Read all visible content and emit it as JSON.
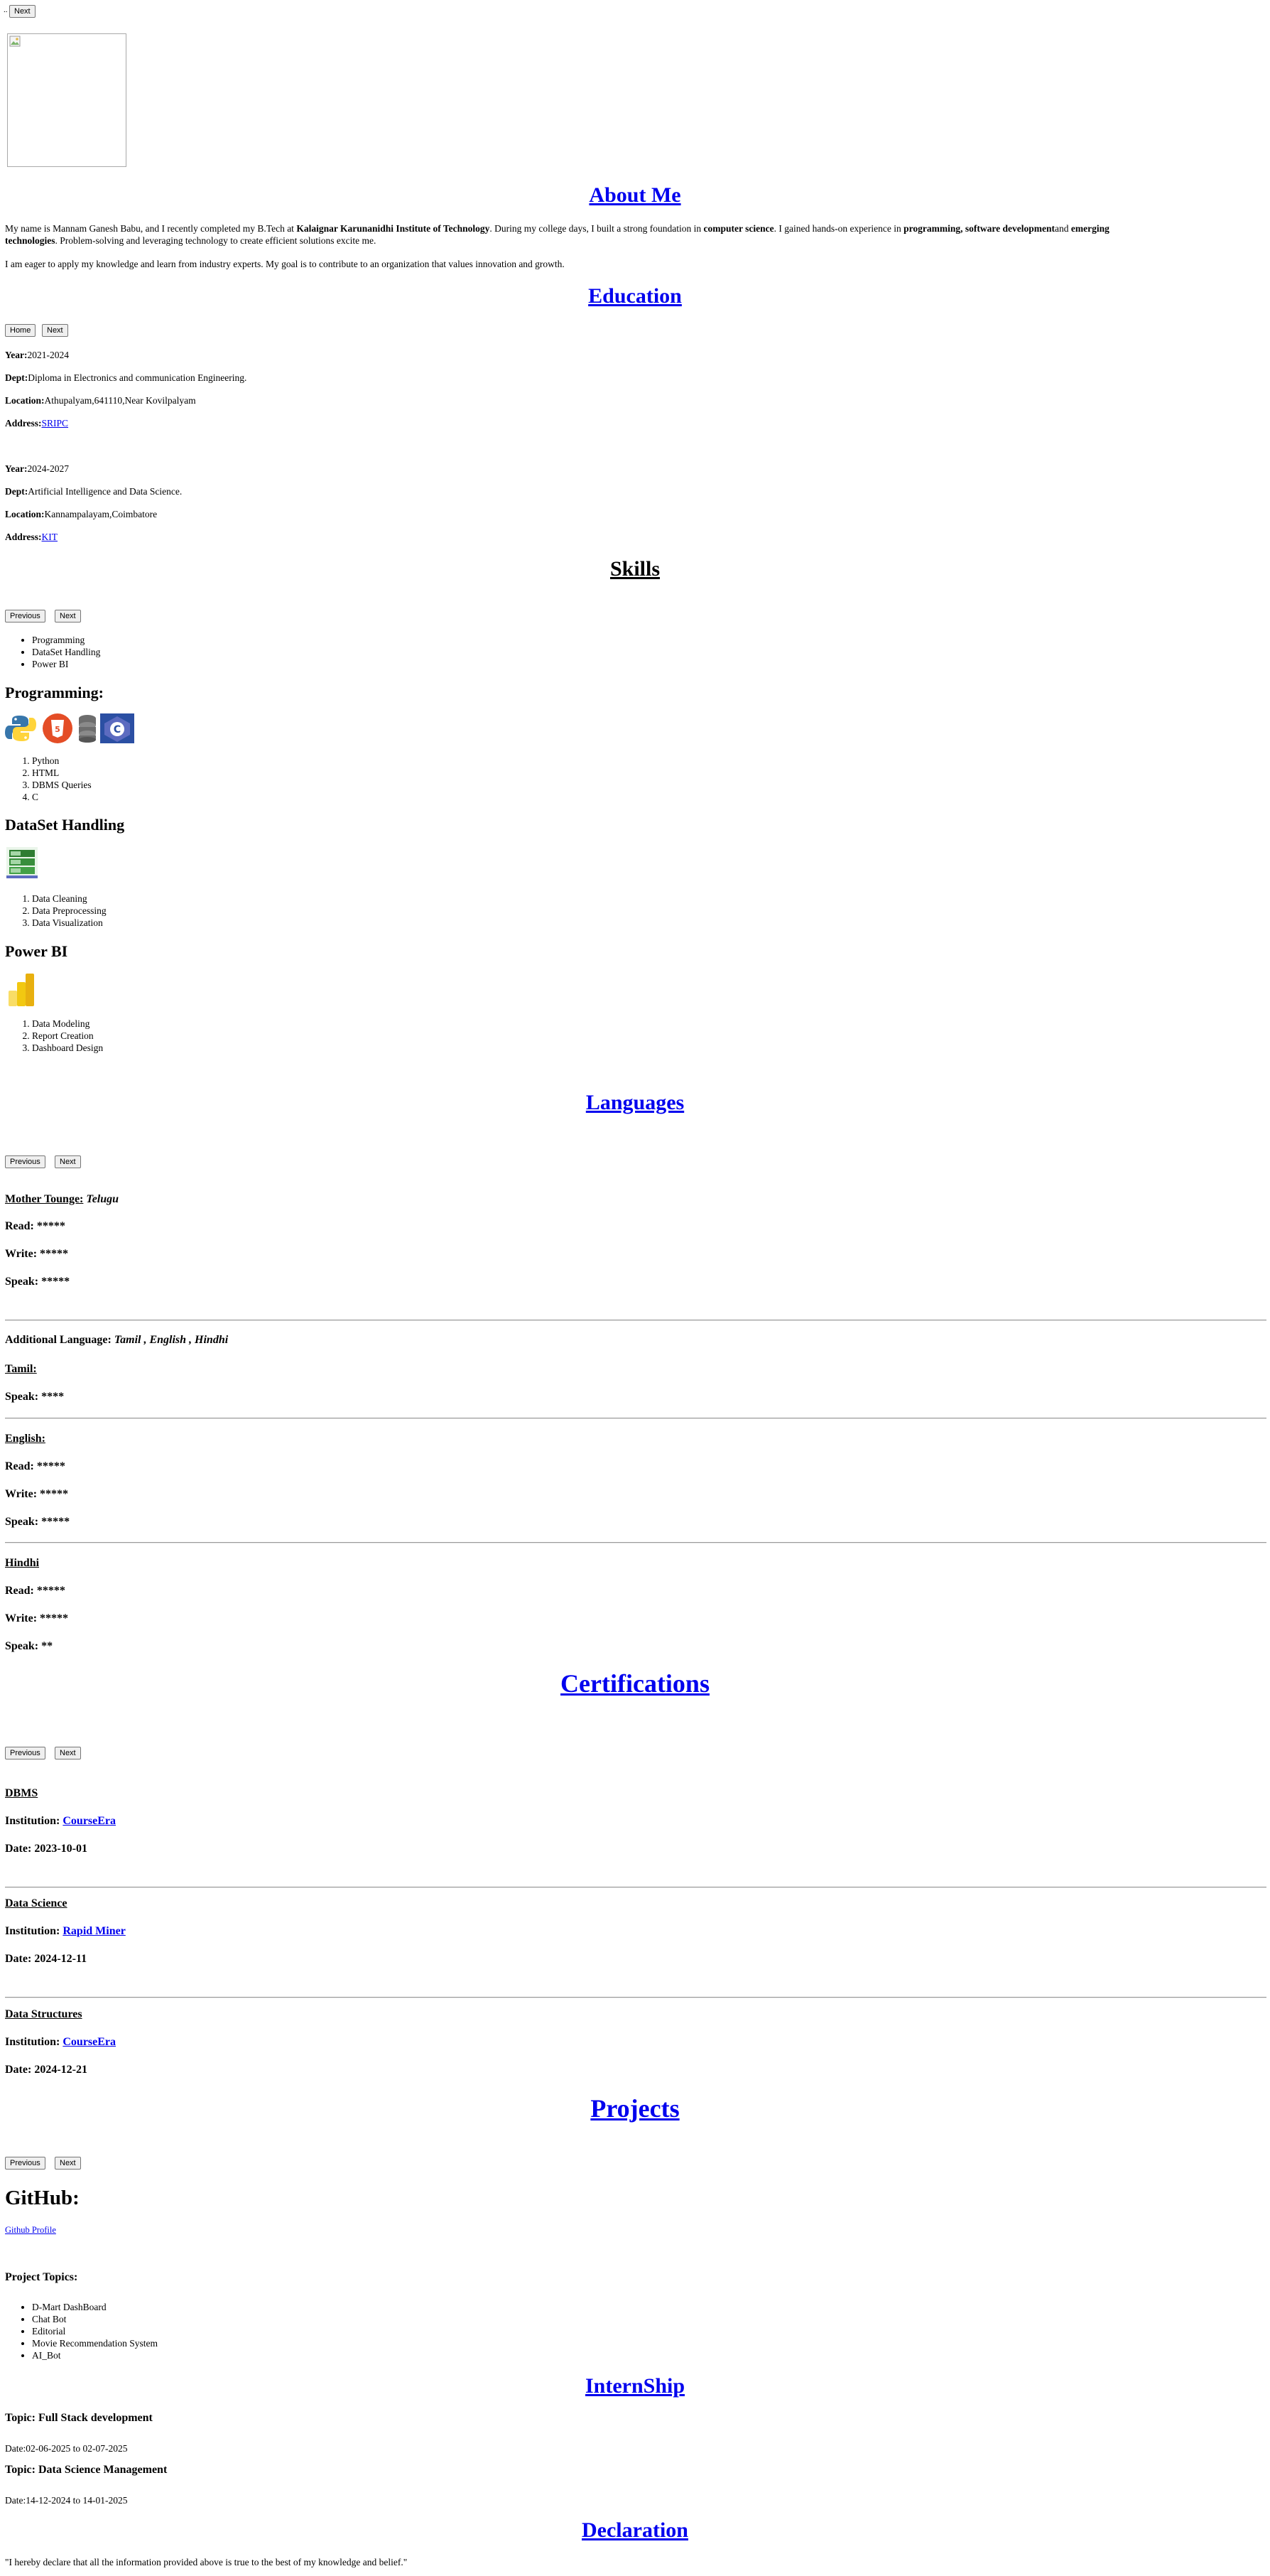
{
  "topnav": {
    "dots": "..",
    "next_label": "Next"
  },
  "about": {
    "heading": "About Me",
    "p1_a": "My name is Mannam Ganesh Babu, and I recently completed my B.Tech at ",
    "p1_b": "Kalaignar Karunanidhi Institute of Technology",
    "p1_c": ". During my college days, I built a strong foundation in ",
    "p1_d": "computer science",
    "p1_e": ". I gained hands-on experience in ",
    "p1_f": "programming, software development",
    "p1_g": "and ",
    "p1_h": "emerging",
    "p1_i": "technologies",
    "p1_j": ". Problem-solving and leveraging technology to create efficient solutions excite me.",
    "p2": "I am eager to apply my knowledge and learn from industry experts. My goal is to contribute to an organization that values innovation and growth."
  },
  "education": {
    "heading": "Education",
    "home_label": "Home",
    "next_label": "Next",
    "labels": {
      "year": "Year:",
      "dept": "Dept:",
      "location": "Location:",
      "address": "Address:"
    },
    "entries": [
      {
        "year": "2021-2024",
        "dept": "Diploma in Electronics and communication Engineering.",
        "location": "Athupalyam,641110,Near Kovilpalyam",
        "address": "SRIPC"
      },
      {
        "year": "2024-2027",
        "dept": "Artificial Intelligence and Data Science.",
        "location": "Kannampalayam,Coimbatore",
        "address": "KIT"
      }
    ]
  },
  "skills": {
    "heading": "Skills",
    "previous_label": "Previous",
    "next_label": "Next",
    "list": [
      "Programming",
      "DataSet Handling",
      "Power BI"
    ],
    "programming": {
      "title": "Programming:",
      "items": [
        "Python",
        "HTML",
        "DBMS Queries",
        "C"
      ],
      "icons": [
        "python-icon",
        "html5-icon",
        "database-icon",
        "c-language-icon"
      ]
    },
    "dataset": {
      "title": "DataSet Handling",
      "items": [
        "Data Cleaning",
        "Data Preprocessing",
        "Data Visualization"
      ],
      "icons": [
        "dataset-icon"
      ]
    },
    "powerbi": {
      "title": "Power BI",
      "items": [
        "Data Modeling",
        "Report Creation",
        "Dashboard Design"
      ],
      "icons": [
        "power-bi-icon"
      ]
    }
  },
  "languages": {
    "heading": "Languages",
    "previous_label": "Previous",
    "next_label": "Next",
    "mother_tongue_label": "Mother Tounge:",
    "mother_tongue": "Telugu",
    "read_label": "Read:",
    "write_label": "Write:",
    "speak_label": "Speak:",
    "mother": {
      "read": "*****",
      "write": "*****",
      "speak": "*****"
    },
    "additional_label": "Additional Language:",
    "additional_value": "Tamil , English , Hindhi",
    "tamil": {
      "name": "Tamil:",
      "speak": "****"
    },
    "english": {
      "name": "English:",
      "read": "*****",
      "write": "*****",
      "speak": "*****"
    },
    "hindhi": {
      "name": "Hindhi",
      "read": "*****",
      "write": "*****",
      "speak": "**"
    }
  },
  "certifications": {
    "heading": "Certifications",
    "previous_label": "Previous",
    "next_label": "Next",
    "institution_label": "Institution:",
    "date_label": "Date:",
    "items": [
      {
        "name": "DBMS",
        "institution": "CourseEra",
        "date": "2023-10-01"
      },
      {
        "name": "Data Science",
        "institution": "Rapid Miner",
        "date": "2024-12-11"
      },
      {
        "name": "Data Structures",
        "institution": "CourseEra",
        "date": "2024-12-21"
      }
    ]
  },
  "projects": {
    "heading": "Projects",
    "previous_label": "Previous",
    "next_label": "Next",
    "github_title": "GitHub:",
    "github_link": "Github Profile",
    "topics_label": "Project Topics:",
    "topics": [
      "D-Mart DashBoard",
      "Chat Bot",
      "Editorial",
      "Movie Recommendation System",
      "AI_Bot"
    ]
  },
  "internship": {
    "heading": "InternShip",
    "items": [
      {
        "topic": "Topic: Full Stack development",
        "date": "Date:02-06-2025 to 02-07-2025"
      },
      {
        "topic": "Topic: Data Science Management",
        "date": "Date:14-12-2024 to 14-01-2025"
      }
    ]
  },
  "declaration": {
    "heading": "Declaration",
    "text": "\"I hereby declare that all the information provided above is true to the best of my knowledge and belief.\""
  },
  "profile_image": {
    "alt": ""
  }
}
